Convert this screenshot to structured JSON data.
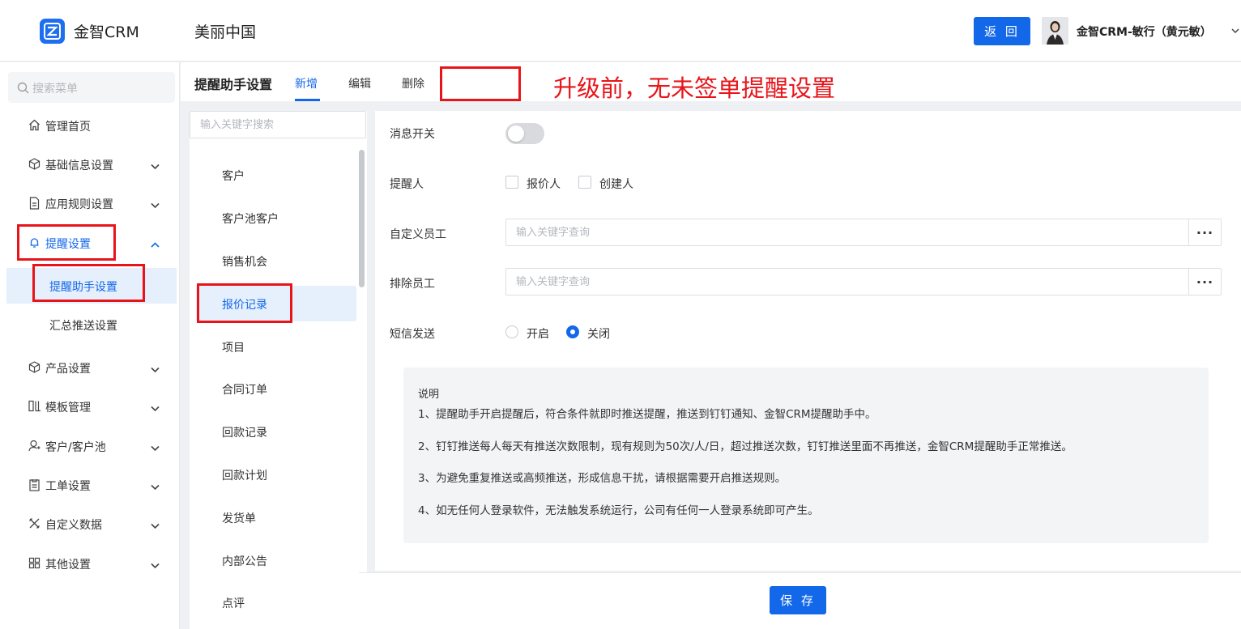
{
  "header": {
    "logo_icon": "logo-z-icon",
    "logo_text": "金智CRM",
    "company": "美丽中国",
    "back_label": "返 回",
    "username": "金智CRM-敏行（黄元敏）"
  },
  "sidebar": {
    "search_placeholder": "搜索菜单",
    "items": [
      {
        "label": "管理首页",
        "icon": "home-icon"
      },
      {
        "label": "基础信息设置",
        "icon": "cube-icon"
      },
      {
        "label": "应用规则设置",
        "icon": "document-icon"
      },
      {
        "label": "提醒设置",
        "icon": "bell-icon"
      },
      {
        "label": "产品设置",
        "icon": "cube-icon"
      },
      {
        "label": "模板管理",
        "icon": "template-icon"
      },
      {
        "label": "客户/客户池",
        "icon": "user-icon"
      },
      {
        "label": "工单设置",
        "icon": "clipboard-icon"
      },
      {
        "label": "自定义数据",
        "icon": "tools-icon"
      },
      {
        "label": "其他设置",
        "icon": "grid-icon"
      }
    ],
    "sub_items": [
      {
        "label": "提醒助手设置",
        "active": true
      },
      {
        "label": "汇总推送设置",
        "active": false
      }
    ]
  },
  "tabbar": {
    "title": "提醒助手设置",
    "tabs": [
      "新增",
      "编辑",
      "删除"
    ],
    "active_tab": "新增"
  },
  "annotation": {
    "text": "升级前，无未签单提醒设置",
    "color": "#e8141a"
  },
  "modules": {
    "search_placeholder": "输入关键字搜索",
    "items": [
      "客户",
      "客户池客户",
      "销售机会",
      "报价记录",
      "项目",
      "合同订单",
      "回款记录",
      "回款计划",
      "发货单",
      "内部公告",
      "点评"
    ],
    "active": "报价记录"
  },
  "form": {
    "switch_label": "消息开关",
    "switch_on": false,
    "reminder_label": "提醒人",
    "reminder_options": [
      "报价人",
      "创建人"
    ],
    "custom_label": "自定义员工",
    "custom_placeholder": "输入关键字查询",
    "exclude_label": "排除员工",
    "exclude_placeholder": "输入关键字查询",
    "dots_label": "···",
    "sms_label": "短信发送",
    "sms_options": [
      "开启",
      "关闭"
    ],
    "sms_selected": "关闭"
  },
  "description": {
    "title": "说明",
    "lines": [
      "1、提醒助手开启提醒后，符合条件就即时推送提醒，推送到钉钉通知、金智CRM提醒助手中。",
      "2、钉钉推送每人每天有推送次数限制，现有规则为50次/人/日，超过推送次数，钉钉推送里面不再推送，金智CRM提醒助手正常推送。",
      "3、为避免重复推送或高频推送，形成信息干扰，请根据需要开启推送规则。",
      "4、如无任何人登录软件，无法触发系统运行，公司有任何一人登录系统即可产生。"
    ]
  },
  "footer": {
    "save_label": "保 存"
  },
  "colors": {
    "primary": "#1368ea",
    "annotation_red": "#e8141a"
  }
}
